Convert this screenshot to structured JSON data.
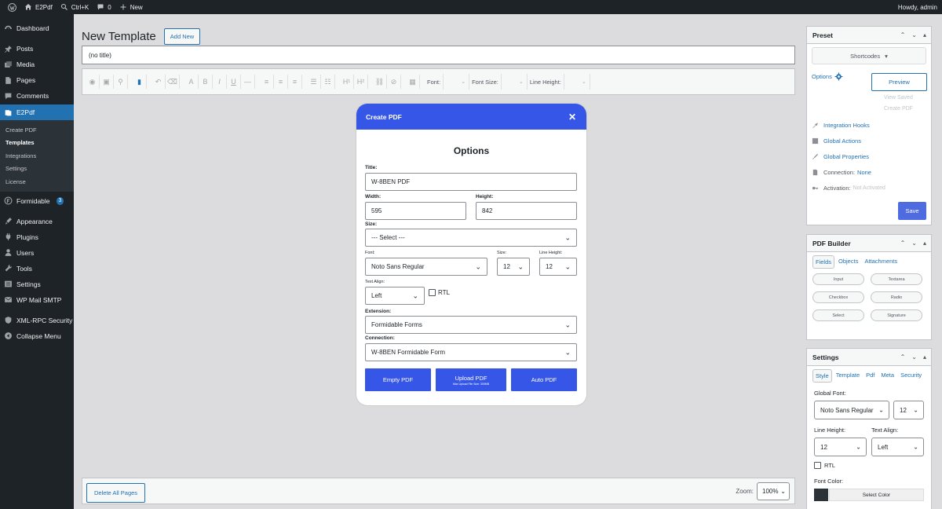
{
  "adminbar": {
    "site": "E2Pdf",
    "search": "Ctrl+K",
    "comments": "0",
    "new": "New",
    "greeting": "Howdy, admin"
  },
  "sidebar": {
    "dashboard": "Dashboard",
    "posts": "Posts",
    "media": "Media",
    "pages": "Pages",
    "comments": "Comments",
    "e2pdf": "E2Pdf",
    "sub": [
      "Create PDF",
      "Templates",
      "Integrations",
      "Settings",
      "License"
    ],
    "formidable": "Formidable",
    "formidable_badge": "3",
    "appearance": "Appearance",
    "plugins": "Plugins",
    "users": "Users",
    "tools": "Tools",
    "settings": "Settings",
    "wpmail": "WP Mail SMTP",
    "xmlrpc": "XML-RPC Security",
    "collapse": "Collapse Menu"
  },
  "page": {
    "title": "New Template",
    "add_new": "Add New",
    "post_title": "(no title)"
  },
  "toolbar": {
    "font_label": "Font:",
    "font_size_label": "Font Size:",
    "line_height_label": "Line Height:"
  },
  "canvas": {
    "delete_all": "Delete All Pages",
    "zoom_label": "Zoom:",
    "zoom_value": "100%"
  },
  "preset": {
    "title": "Preset",
    "shortcodes": "Shortcodes",
    "options": "Options",
    "preview": "Preview",
    "view_saved": "View Saved",
    "create_pdf": "Create PDF",
    "integration_hooks": "Integration Hooks",
    "global_actions": "Global Actions",
    "global_properties": "Global Properties",
    "connection_label": "Connection:",
    "connection_value": "None",
    "activation_label": "Activation:",
    "activation_value": "Not Activated",
    "save": "Save"
  },
  "builder": {
    "title": "PDF Builder",
    "tabs": [
      "Fields",
      "Objects",
      "Attachments"
    ],
    "fields": [
      "Input",
      "Textarea",
      "Checkbox",
      "Radio",
      "Select",
      "Signature"
    ]
  },
  "settings": {
    "title": "Settings",
    "tabs": [
      "Style",
      "Template",
      "Pdf",
      "Meta",
      "Security"
    ],
    "global_font_label": "Global Font:",
    "global_font": "Noto Sans Regular",
    "global_size": "12",
    "line_height_label": "Line Height:",
    "line_height": "12",
    "text_align_label": "Text Align:",
    "text_align": "Left",
    "rtl": "RTL",
    "font_color_label": "Font Color:",
    "select_color": "Select Color"
  },
  "modal": {
    "header": "Create PDF",
    "heading": "Options",
    "title_label": "Title:",
    "title_value": "W-8BEN PDF",
    "width_label": "Width:",
    "width_value": "595",
    "height_label": "Height:",
    "height_value": "842",
    "size_label": "Size:",
    "size_value": "--- Select ---",
    "font_label": "Font:",
    "font_value": "Noto Sans Regular",
    "fsize_label": "Size:",
    "fsize_value": "12",
    "lh_label": "Line Height:",
    "lh_value": "12",
    "align_label": "Text Align:",
    "align_value": "Left",
    "rtl": "RTL",
    "ext_label": "Extension:",
    "ext_value": "Formidable Forms",
    "conn_label": "Connection:",
    "conn_value": "W-8BEN Formidable Form",
    "btn_empty": "Empty PDF",
    "btn_upload": "Upload PDF",
    "btn_upload_note": "Max Upload File Size: 300MB",
    "btn_auto": "Auto PDF"
  },
  "colors": {
    "accent": "#2271b1",
    "modal_blue": "#3556e6",
    "admin_dark": "#1d2327",
    "save_blue": "#4f6be0"
  }
}
